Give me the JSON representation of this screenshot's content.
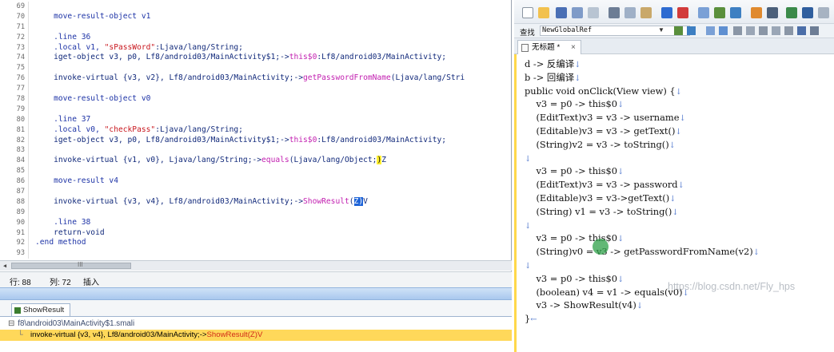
{
  "left_editor": {
    "lines": [
      {
        "num": "69",
        "parts": []
      },
      {
        "num": "70",
        "parts": [
          {
            "t": "    move-result-object v1",
            "c": "kw"
          }
        ]
      },
      {
        "num": "71",
        "parts": []
      },
      {
        "num": "72",
        "parts": [
          {
            "t": "    .line 36",
            "c": "kw"
          }
        ]
      },
      {
        "num": "73",
        "parts": [
          {
            "t": "    .local v1, ",
            "c": "kw"
          },
          {
            "t": "\"sPassWord\"",
            "c": "str"
          },
          {
            "t": ":Ljava/lang/String;",
            "c": ""
          }
        ]
      },
      {
        "num": "74",
        "parts": [
          {
            "t": "    iget-object v3, p0, Lf8/android03/MainActivity$1;->",
            "c": ""
          },
          {
            "t": "this$0",
            "c": "meth"
          },
          {
            "t": ":Lf8/android03/MainActivity;",
            "c": ""
          }
        ]
      },
      {
        "num": "75",
        "parts": []
      },
      {
        "num": "76",
        "parts": [
          {
            "t": "    invoke-virtual {v3, v2}, Lf8/android03/MainActivity;->",
            "c": ""
          },
          {
            "t": "getPasswordFromName",
            "c": "meth"
          },
          {
            "t": "(Ljava/lang/Stri",
            "c": ""
          }
        ]
      },
      {
        "num": "77",
        "parts": []
      },
      {
        "num": "78",
        "parts": [
          {
            "t": "    move-result-object v0",
            "c": "kw"
          }
        ]
      },
      {
        "num": "79",
        "parts": []
      },
      {
        "num": "80",
        "parts": [
          {
            "t": "    .line 37",
            "c": "kw"
          }
        ]
      },
      {
        "num": "81",
        "parts": [
          {
            "t": "    .local v0, ",
            "c": "kw"
          },
          {
            "t": "\"checkPass\"",
            "c": "str"
          },
          {
            "t": ":Ljava/lang/String;",
            "c": ""
          }
        ]
      },
      {
        "num": "82",
        "parts": [
          {
            "t": "    iget-object v3, p0, Lf8/android03/MainActivity$1;->",
            "c": ""
          },
          {
            "t": "this$0",
            "c": "meth"
          },
          {
            "t": ":Lf8/android03/MainActivity;",
            "c": ""
          }
        ]
      },
      {
        "num": "83",
        "parts": []
      },
      {
        "num": "84",
        "parts": [
          {
            "t": "    invoke-virtual {v1, v0}, Ljava/lang/String;->",
            "c": ""
          },
          {
            "t": "equals",
            "c": "meth"
          },
          {
            "t": "(Ljava/lang/Object;",
            "c": ""
          },
          {
            "t": ")",
            "c": "sel"
          },
          {
            "t": "Z",
            "c": ""
          }
        ]
      },
      {
        "num": "85",
        "parts": []
      },
      {
        "num": "86",
        "parts": [
          {
            "t": "    move-result v4",
            "c": "kw"
          }
        ]
      },
      {
        "num": "87",
        "parts": []
      },
      {
        "num": "88",
        "parts": [
          {
            "t": "    invoke-virtual {v3, v4}, Lf8/android03/MainActivity;->",
            "c": ""
          },
          {
            "t": "ShowResult",
            "c": "meth"
          },
          {
            "t": "(",
            "c": ""
          },
          {
            "t": "Z)",
            "c": "cur"
          },
          {
            "t": "V",
            "c": ""
          }
        ]
      },
      {
        "num": "89",
        "parts": []
      },
      {
        "num": "90",
        "parts": [
          {
            "t": "    .line 38",
            "c": "kw"
          }
        ]
      },
      {
        "num": "91",
        "parts": [
          {
            "t": "    return-void",
            "c": ""
          }
        ]
      },
      {
        "num": "92",
        "parts": [
          {
            "t": ".end method",
            "c": "kw"
          }
        ]
      },
      {
        "num": "93",
        "parts": []
      }
    ]
  },
  "hscroll": {
    "grip": "III"
  },
  "status": {
    "row_label": "行: 88",
    "col_label": "列: 72",
    "mode": "插入"
  },
  "results": {
    "tab_label": "ShowResult",
    "file_toggle": "⊟",
    "file_path": "f8\\android03\\MainActivity$1.smali",
    "hit_prefix": "invoke-virtual {v3, v4}, Lf8/android03/MainActivity;->",
    "hit_method": "ShowResult(Z)V"
  },
  "right": {
    "find_label": "查找",
    "find_value": "NewGlobalRef",
    "doc_tab_label": "无标题 *",
    "doc_tab_close": "×",
    "lines": [
      "d -> 反编译",
      "b -> 回编译",
      "public void onClick(View view) {",
      "    v3 = p0 -> this$0",
      "    (EditText)v3 = v3 -> username",
      "    (Editable)v3 = v3 -> getText()",
      "    (String)v2 = v3 -> toString()",
      "",
      "    v3 = p0 -> this$0",
      "    (EditText)v3 = v3 -> password",
      "    (Editable)v3 = v3->getText()",
      "    (String) v1 = v3 -> toString()",
      "",
      "    v3 = p0 -> this$0",
      "    (String)v0 = v3 -> getPasswordFromName(v2)",
      "",
      "    v3 = p0 -> this$0",
      "    (boolean) v4 = v1 -> equals(v0)",
      "    v3 -> ShowResult(v4)",
      "}"
    ],
    "line_mark": "↓",
    "end_mark": "←",
    "watermark": "https://blog.csdn.net/Fly_hps"
  },
  "colors": {
    "highlight_yellow": "#ffd85a",
    "method": "#c21fb0",
    "string": "#c8161d",
    "keyword": "#1d33a6",
    "cursor_blue": "#1e64d8"
  }
}
